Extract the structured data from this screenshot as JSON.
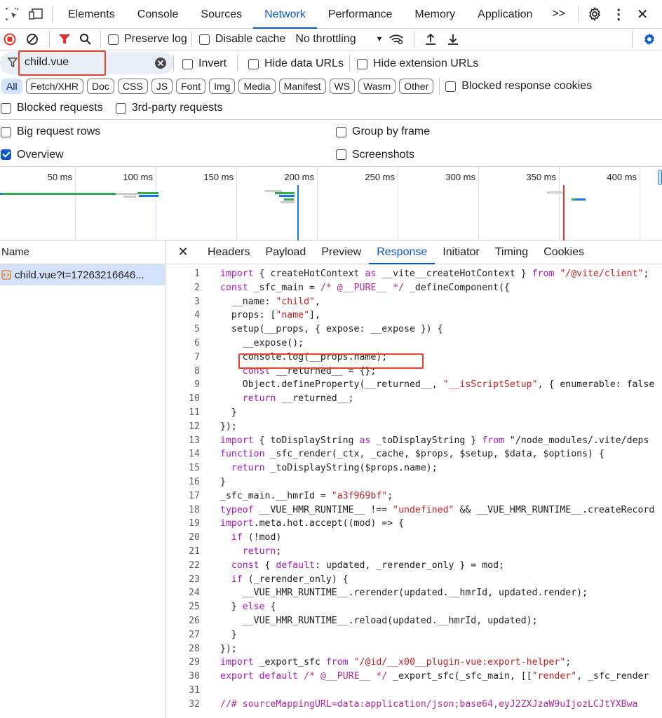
{
  "tabs": [
    "Elements",
    "Console",
    "Sources",
    "Network",
    "Performance",
    "Memory",
    "Application"
  ],
  "active_tab": "Network",
  "more_tabs": ">>",
  "toolbar": {
    "preserve_log": "Preserve log",
    "disable_cache": "Disable cache",
    "throttling": "No throttling"
  },
  "filter": {
    "value": "child.vue",
    "invert": "Invert",
    "hide_data_urls": "Hide data URLs",
    "hide_ext_urls": "Hide extension URLs"
  },
  "types": [
    "All",
    "Fetch/XHR",
    "Doc",
    "CSS",
    "JS",
    "Font",
    "Img",
    "Media",
    "Manifest",
    "WS",
    "Wasm",
    "Other"
  ],
  "blocked_response_cookies": "Blocked response cookies",
  "blocked_requests": "Blocked requests",
  "third_party": "3rd-party requests",
  "settings": {
    "big_rows": "Big request rows",
    "group_by_frame": "Group by frame",
    "overview": "Overview",
    "screenshots": "Screenshots"
  },
  "timeline_ticks": [
    "50 ms",
    "100 ms",
    "150 ms",
    "200 ms",
    "250 ms",
    "300 ms",
    "350 ms",
    "400 ms"
  ],
  "name_header": "Name",
  "request_name": "child.vue?t=17263216646...",
  "response_tabs": [
    "Headers",
    "Payload",
    "Preview",
    "Response",
    "Initiator",
    "Timing",
    "Cookies"
  ],
  "active_response_tab": "Response",
  "code_lines": [
    "import { createHotContext as __vite__createHotContext } from \"/@vite/client\";",
    "const _sfc_main = /* @__PURE__ */ _defineComponent({",
    "  __name: \"child\",",
    "  props: [\"name\"],",
    "  setup(__props, { expose: __expose }) {",
    "    __expose();",
    "    console.log(__props.name);",
    "    const __returned__ = {};",
    "    Object.defineProperty(__returned__, \"__isScriptSetup\", { enumerable: false",
    "    return __returned__;",
    "  }",
    "});",
    "import { toDisplayString as _toDisplayString } from \"/node_modules/.vite/deps",
    "function _sfc_render(_ctx, _cache, $props, $setup, $data, $options) {",
    "  return _toDisplayString($props.name);",
    "}",
    "_sfc_main.__hmrId = \"a3f969bf\";",
    "typeof __VUE_HMR_RUNTIME__ !== \"undefined\" && __VUE_HMR_RUNTIME__.createRecord",
    "import.meta.hot.accept((mod) => {",
    "  if (!mod)",
    "    return;",
    "  const { default: updated, _rerender_only } = mod;",
    "  if (_rerender_only) {",
    "    __VUE_HMR_RUNTIME__.rerender(updated.__hmrId, updated.render);",
    "  } else {",
    "    __VUE_HMR_RUNTIME__.reload(updated.__hmrId, updated);",
    "  }",
    "});",
    "import _export_sfc from \"/@id/__x00__plugin-vue:export-helper\";",
    "export default /* @__PURE__ */ _export_sfc(_sfc_main, [[\"render\", _sfc_render",
    "",
    "//# sourceMappingURL=data:application/json;base64,eyJ2ZXJzaW9uIjozLCJtYXBwa"
  ],
  "colors": {
    "accent": "#0b57d0",
    "highlight_box": "#e2462f",
    "record_red": "#dc362e"
  }
}
